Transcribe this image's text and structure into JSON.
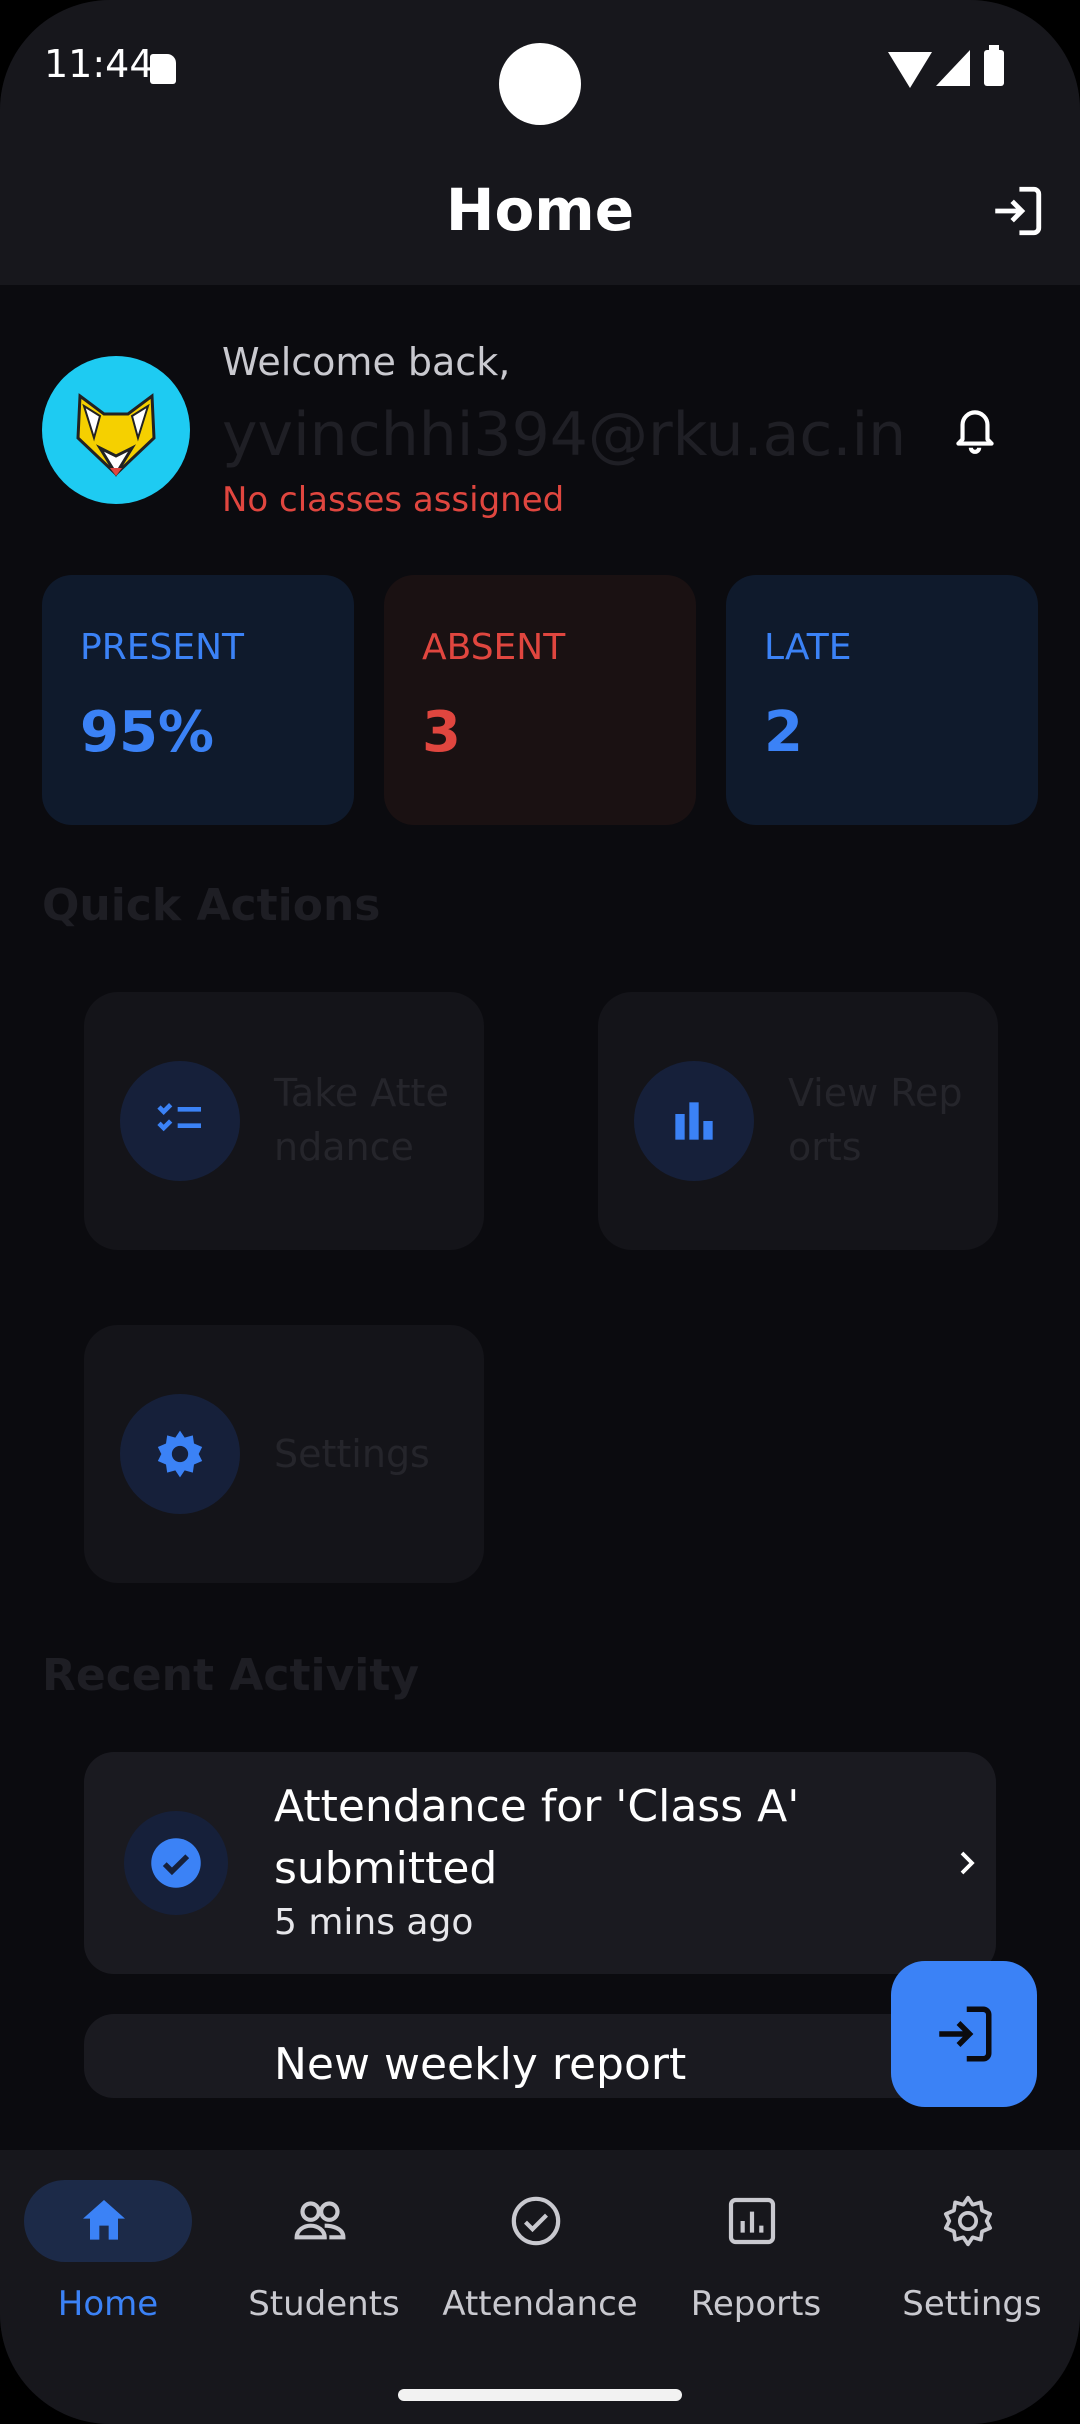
{
  "status": {
    "time": "11:44"
  },
  "appbar": {
    "title": "Home"
  },
  "profile": {
    "welcome": "Welcome back,",
    "email": "yvinchhi394@rku.ac.in",
    "notice": "No classes assigned"
  },
  "stats": [
    {
      "label": "PRESENT",
      "value": "95%"
    },
    {
      "label": "ABSENT",
      "value": "3"
    },
    {
      "label": "LATE",
      "value": "2"
    }
  ],
  "quick_actions": {
    "title": "Quick Actions",
    "items": [
      {
        "label": "Take Attendance",
        "icon": "checklist-icon"
      },
      {
        "label": "View Reports",
        "icon": "bar-chart-icon"
      },
      {
        "label": "Settings",
        "icon": "gear-icon"
      }
    ]
  },
  "recent_activity": {
    "title": "Recent Activity",
    "items": [
      {
        "title": "Attendance for 'Class A' submitted",
        "time": "5 mins ago"
      },
      {
        "title": "New weekly report",
        "time": ""
      }
    ]
  },
  "bottom_nav": [
    {
      "label": "Home",
      "icon": "home-icon",
      "active": true
    },
    {
      "label": "Students",
      "icon": "people-icon",
      "active": false
    },
    {
      "label": "Attendance",
      "icon": "check-circle-icon",
      "active": false
    },
    {
      "label": "Reports",
      "icon": "report-icon",
      "active": false
    },
    {
      "label": "Settings",
      "icon": "gear-icon",
      "active": false
    }
  ],
  "colors": {
    "accent": "#3b82f6",
    "danger": "#e0463f",
    "background": "#0b0b0f"
  }
}
